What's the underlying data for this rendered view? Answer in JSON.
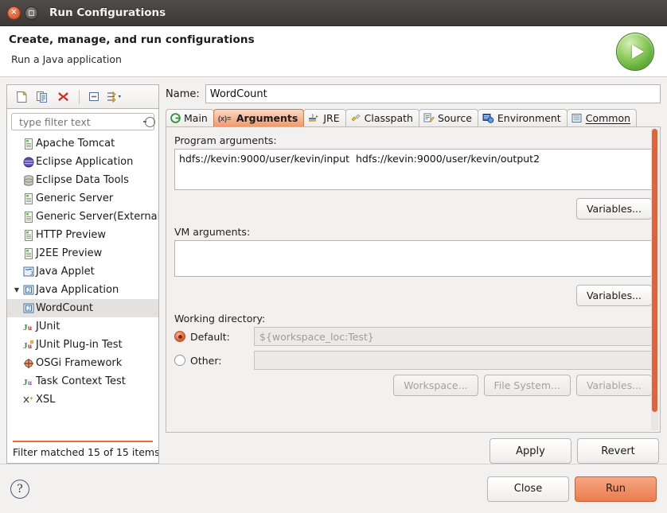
{
  "window": {
    "title": "Run Configurations",
    "close_label": "×",
    "maximize_label": ""
  },
  "header": {
    "title": "Create, manage, and run configurations",
    "subtitle": "Run a Java application",
    "icon": "run-play-icon"
  },
  "left_panel": {
    "toolbar": [
      {
        "name": "new-configuration",
        "icon": "new-document-icon"
      },
      {
        "name": "duplicate-configuration",
        "icon": "duplicate-icon"
      },
      {
        "name": "delete-configuration",
        "icon": "delete-x-icon"
      },
      {
        "name": "collapse-all",
        "icon": "collapse-all-icon"
      },
      {
        "name": "filter-configurations",
        "icon": "filter-icon"
      }
    ],
    "filter": {
      "placeholder": "type filter text",
      "value": "",
      "clear_label": "x"
    },
    "tree": [
      {
        "label": "Apache Tomcat",
        "icon": "server-icon",
        "level": 0,
        "expander": "",
        "selected": false
      },
      {
        "label": "Eclipse Application",
        "icon": "eclipse-icon",
        "level": 0,
        "expander": "",
        "selected": false
      },
      {
        "label": "Eclipse Data Tools",
        "icon": "database-icon",
        "level": 0,
        "expander": "",
        "selected": false
      },
      {
        "label": "Generic Server",
        "icon": "server-icon",
        "level": 0,
        "expander": "",
        "selected": false
      },
      {
        "label": "Generic Server(External Launch)",
        "icon": "server-icon",
        "level": 0,
        "expander": "",
        "selected": false
      },
      {
        "label": "HTTP Preview",
        "icon": "server-icon",
        "level": 0,
        "expander": "",
        "selected": false
      },
      {
        "label": "J2EE Preview",
        "icon": "server-icon",
        "level": 0,
        "expander": "",
        "selected": false
      },
      {
        "label": "Java Applet",
        "icon": "java-applet-icon",
        "level": 0,
        "expander": "",
        "selected": false
      },
      {
        "label": "Java Application",
        "icon": "java-application-icon",
        "level": 0,
        "expander": "▼",
        "selected": false
      },
      {
        "label": "WordCount",
        "icon": "java-application-icon",
        "level": 1,
        "expander": "",
        "selected": true
      },
      {
        "label": "JUnit",
        "icon": "junit-icon",
        "level": 0,
        "expander": "",
        "selected": false
      },
      {
        "label": "JUnit Plug-in Test",
        "icon": "junit-plugin-icon",
        "level": 0,
        "expander": "",
        "selected": false
      },
      {
        "label": "OSGi Framework",
        "icon": "osgi-icon",
        "level": 0,
        "expander": "",
        "selected": false
      },
      {
        "label": "Task Context Test",
        "icon": "task-context-icon",
        "level": 0,
        "expander": "",
        "selected": false
      },
      {
        "label": "XSL",
        "icon": "xsl-icon",
        "level": 0,
        "expander": "",
        "selected": false
      }
    ],
    "footer": "Filter matched 15 of 15 items"
  },
  "right_panel": {
    "name_label": "Name:",
    "name_value": "WordCount",
    "tabs": [
      {
        "label": "Main",
        "icon": "main-tab-icon",
        "active": false
      },
      {
        "label": "Arguments",
        "icon": "arguments-tab-icon",
        "active": true
      },
      {
        "label": "JRE",
        "icon": "jre-tab-icon",
        "active": false
      },
      {
        "label": "Classpath",
        "icon": "classpath-tab-icon",
        "active": false
      },
      {
        "label": "Source",
        "icon": "source-tab-icon",
        "active": false
      },
      {
        "label": "Environment",
        "icon": "environment-tab-icon",
        "active": false
      },
      {
        "label": "Common",
        "icon": "common-tab-icon",
        "active": false
      }
    ],
    "program_arguments": {
      "label": "Program arguments:",
      "value": "hdfs://kevin:9000/user/kevin/input  hdfs://kevin:9000/user/kevin/output2",
      "variables_button": "Variables..."
    },
    "vm_arguments": {
      "label": "VM arguments:",
      "value": "",
      "variables_button": "Variables..."
    },
    "working_directory": {
      "label": "Working directory:",
      "default_label": "Default:",
      "default_value": "${workspace_loc:Test}",
      "default_selected": true,
      "other_label": "Other:",
      "other_value": "",
      "workspace_button": "Workspace...",
      "file_system_button": "File System...",
      "variables_button": "Variables..."
    },
    "apply_button": "Apply",
    "revert_button": "Revert"
  },
  "footer": {
    "help_label": "?",
    "close_button": "Close",
    "run_button": "Run"
  },
  "colors": {
    "accent": "#e0643a",
    "run_button": "#ec7c4c",
    "titlebar": "#3c3835",
    "active_tab": "#f0996a"
  }
}
